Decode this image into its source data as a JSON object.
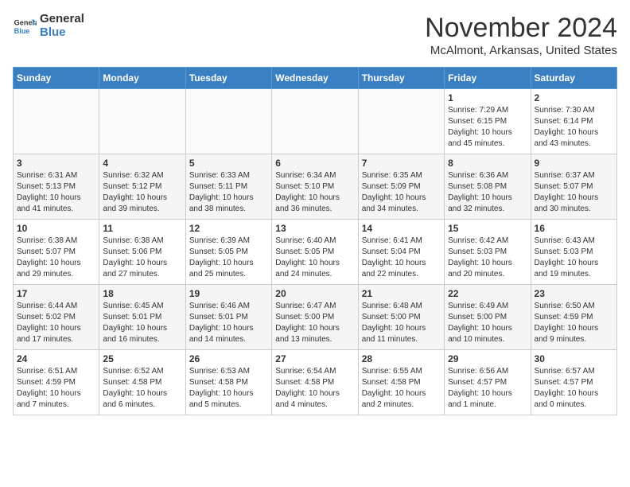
{
  "logo": {
    "general": "General",
    "blue": "Blue"
  },
  "header": {
    "month": "November 2024",
    "location": "McAlmont, Arkansas, United States"
  },
  "weekdays": [
    "Sunday",
    "Monday",
    "Tuesday",
    "Wednesday",
    "Thursday",
    "Friday",
    "Saturday"
  ],
  "weeks": [
    [
      {
        "day": "",
        "info": ""
      },
      {
        "day": "",
        "info": ""
      },
      {
        "day": "",
        "info": ""
      },
      {
        "day": "",
        "info": ""
      },
      {
        "day": "",
        "info": ""
      },
      {
        "day": "1",
        "info": "Sunrise: 7:29 AM\nSunset: 6:15 PM\nDaylight: 10 hours\nand 45 minutes."
      },
      {
        "day": "2",
        "info": "Sunrise: 7:30 AM\nSunset: 6:14 PM\nDaylight: 10 hours\nand 43 minutes."
      }
    ],
    [
      {
        "day": "3",
        "info": "Sunrise: 6:31 AM\nSunset: 5:13 PM\nDaylight: 10 hours\nand 41 minutes."
      },
      {
        "day": "4",
        "info": "Sunrise: 6:32 AM\nSunset: 5:12 PM\nDaylight: 10 hours\nand 39 minutes."
      },
      {
        "day": "5",
        "info": "Sunrise: 6:33 AM\nSunset: 5:11 PM\nDaylight: 10 hours\nand 38 minutes."
      },
      {
        "day": "6",
        "info": "Sunrise: 6:34 AM\nSunset: 5:10 PM\nDaylight: 10 hours\nand 36 minutes."
      },
      {
        "day": "7",
        "info": "Sunrise: 6:35 AM\nSunset: 5:09 PM\nDaylight: 10 hours\nand 34 minutes."
      },
      {
        "day": "8",
        "info": "Sunrise: 6:36 AM\nSunset: 5:08 PM\nDaylight: 10 hours\nand 32 minutes."
      },
      {
        "day": "9",
        "info": "Sunrise: 6:37 AM\nSunset: 5:07 PM\nDaylight: 10 hours\nand 30 minutes."
      }
    ],
    [
      {
        "day": "10",
        "info": "Sunrise: 6:38 AM\nSunset: 5:07 PM\nDaylight: 10 hours\nand 29 minutes."
      },
      {
        "day": "11",
        "info": "Sunrise: 6:38 AM\nSunset: 5:06 PM\nDaylight: 10 hours\nand 27 minutes."
      },
      {
        "day": "12",
        "info": "Sunrise: 6:39 AM\nSunset: 5:05 PM\nDaylight: 10 hours\nand 25 minutes."
      },
      {
        "day": "13",
        "info": "Sunrise: 6:40 AM\nSunset: 5:05 PM\nDaylight: 10 hours\nand 24 minutes."
      },
      {
        "day": "14",
        "info": "Sunrise: 6:41 AM\nSunset: 5:04 PM\nDaylight: 10 hours\nand 22 minutes."
      },
      {
        "day": "15",
        "info": "Sunrise: 6:42 AM\nSunset: 5:03 PM\nDaylight: 10 hours\nand 20 minutes."
      },
      {
        "day": "16",
        "info": "Sunrise: 6:43 AM\nSunset: 5:03 PM\nDaylight: 10 hours\nand 19 minutes."
      }
    ],
    [
      {
        "day": "17",
        "info": "Sunrise: 6:44 AM\nSunset: 5:02 PM\nDaylight: 10 hours\nand 17 minutes."
      },
      {
        "day": "18",
        "info": "Sunrise: 6:45 AM\nSunset: 5:01 PM\nDaylight: 10 hours\nand 16 minutes."
      },
      {
        "day": "19",
        "info": "Sunrise: 6:46 AM\nSunset: 5:01 PM\nDaylight: 10 hours\nand 14 minutes."
      },
      {
        "day": "20",
        "info": "Sunrise: 6:47 AM\nSunset: 5:00 PM\nDaylight: 10 hours\nand 13 minutes."
      },
      {
        "day": "21",
        "info": "Sunrise: 6:48 AM\nSunset: 5:00 PM\nDaylight: 10 hours\nand 11 minutes."
      },
      {
        "day": "22",
        "info": "Sunrise: 6:49 AM\nSunset: 5:00 PM\nDaylight: 10 hours\nand 10 minutes."
      },
      {
        "day": "23",
        "info": "Sunrise: 6:50 AM\nSunset: 4:59 PM\nDaylight: 10 hours\nand 9 minutes."
      }
    ],
    [
      {
        "day": "24",
        "info": "Sunrise: 6:51 AM\nSunset: 4:59 PM\nDaylight: 10 hours\nand 7 minutes."
      },
      {
        "day": "25",
        "info": "Sunrise: 6:52 AM\nSunset: 4:58 PM\nDaylight: 10 hours\nand 6 minutes."
      },
      {
        "day": "26",
        "info": "Sunrise: 6:53 AM\nSunset: 4:58 PM\nDaylight: 10 hours\nand 5 minutes."
      },
      {
        "day": "27",
        "info": "Sunrise: 6:54 AM\nSunset: 4:58 PM\nDaylight: 10 hours\nand 4 minutes."
      },
      {
        "day": "28",
        "info": "Sunrise: 6:55 AM\nSunset: 4:58 PM\nDaylight: 10 hours\nand 2 minutes."
      },
      {
        "day": "29",
        "info": "Sunrise: 6:56 AM\nSunset: 4:57 PM\nDaylight: 10 hours\nand 1 minute."
      },
      {
        "day": "30",
        "info": "Sunrise: 6:57 AM\nSunset: 4:57 PM\nDaylight: 10 hours\nand 0 minutes."
      }
    ]
  ]
}
